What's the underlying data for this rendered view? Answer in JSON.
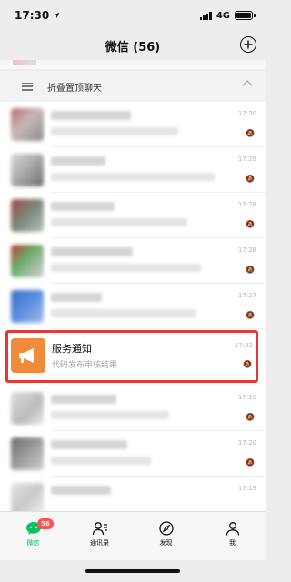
{
  "status_bar": {
    "time": "17:30",
    "network": "4G",
    "location_icon": "location-arrow-icon"
  },
  "header": {
    "title": "微信 (56)",
    "add_icon": "plus-circle-icon"
  },
  "folded_chats": {
    "label": "折叠置顶聊天",
    "icon": "list-icon",
    "chevron": "chevron-up-icon"
  },
  "chat_list": [
    {
      "time": "17:30",
      "name": "",
      "message": "[..."
    },
    {
      "time": "17:29",
      "name": "",
      "message": ""
    },
    {
      "time": "17:28",
      "name": "",
      "message": ""
    },
    {
      "time": "17:28",
      "name": "",
      "message": "[..."
    },
    {
      "time": "17:27",
      "name": "",
      "message": ""
    },
    {
      "time": "17:22",
      "name": "服务通知",
      "message": "代码发布审核结果",
      "highlighted": true
    },
    {
      "time": "17:20",
      "name": "",
      "message": ""
    },
    {
      "time": "17:20",
      "name": "",
      "message": ""
    },
    {
      "time": "17:19",
      "name": "",
      "message": ""
    }
  ],
  "tab_bar": {
    "tabs": [
      {
        "label": "微信",
        "icon": "chat-bubble-icon",
        "active": true,
        "badge": "56"
      },
      {
        "label": "通讯录",
        "icon": "contacts-icon",
        "active": false
      },
      {
        "label": "发现",
        "icon": "compass-icon",
        "active": false
      },
      {
        "label": "我",
        "icon": "person-icon",
        "active": false
      }
    ]
  },
  "colors": {
    "accent": "#07c160",
    "badge": "#fa5151",
    "highlight_border": "#e53935",
    "service_avatar": "#f08a3c"
  }
}
